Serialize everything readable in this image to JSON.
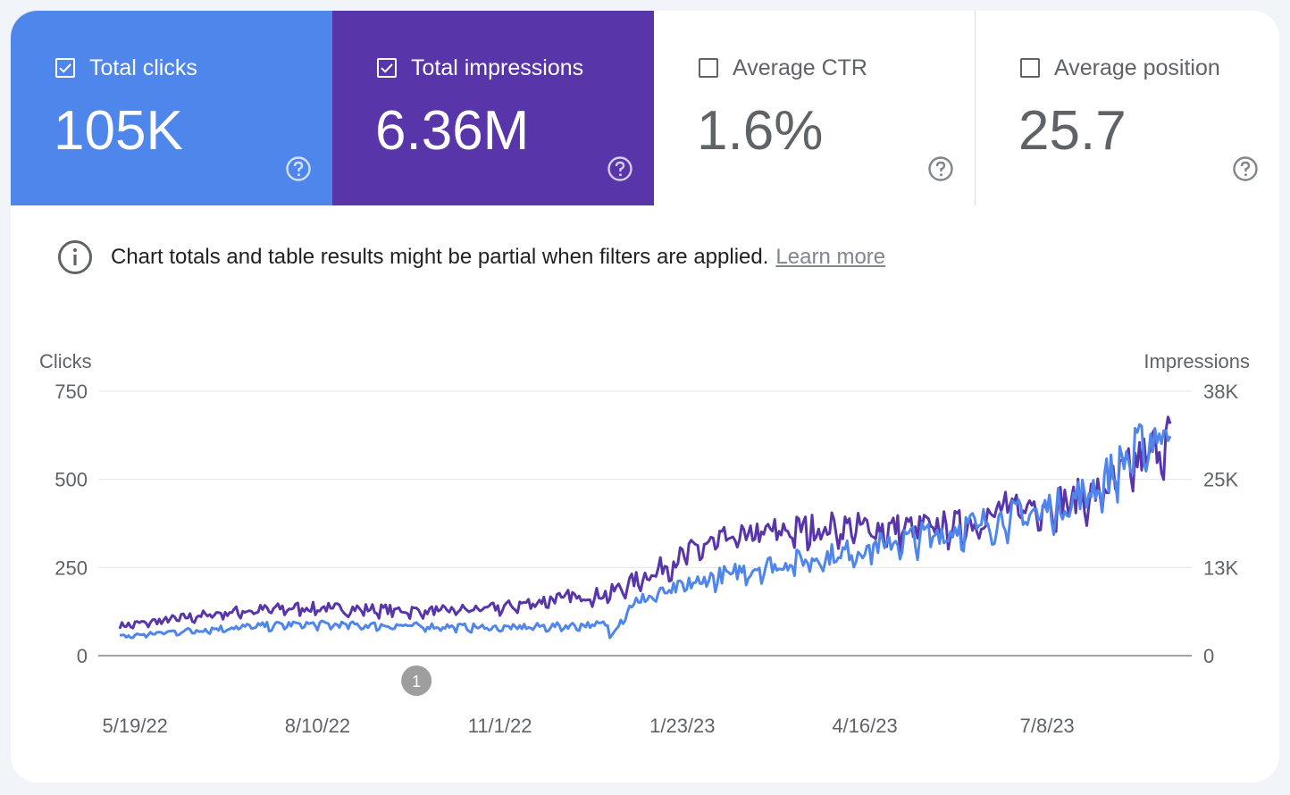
{
  "metrics": [
    {
      "label": "Total clicks",
      "value": "105K",
      "checked": true,
      "color": "#4f86ec"
    },
    {
      "label": "Total impressions",
      "value": "6.36M",
      "checked": true,
      "color": "#5935aa"
    },
    {
      "label": "Average CTR",
      "value": "1.6%",
      "checked": false
    },
    {
      "label": "Average position",
      "value": "25.7",
      "checked": false
    }
  ],
  "icons": {
    "checkbox": "checkbox-icon",
    "help": "help-circle-icon",
    "info": "info-circle-icon"
  },
  "notice": {
    "text": "Chart totals and table results might be partial when filters are applied.",
    "link": "Learn more"
  },
  "chart_data": {
    "type": "line",
    "y_left_title": "Clicks",
    "y_right_title": "Impressions",
    "y_left_ticks": [
      "750",
      "500",
      "250",
      "0"
    ],
    "y_right_ticks": [
      "38K",
      "25K",
      "13K",
      "0"
    ],
    "y_left_range": [
      0,
      750
    ],
    "y_right_range": [
      0,
      38000
    ],
    "x_ticks": [
      "5/19/22",
      "8/10/22",
      "11/1/22",
      "1/23/23",
      "4/16/23",
      "7/8/23"
    ],
    "x_range": [
      "5/12/22",
      "9/2/23"
    ],
    "annotation_marker": {
      "label": "1",
      "date": "9/24/22"
    },
    "grid": true,
    "series": [
      {
        "name": "Total clicks",
        "axis": "left",
        "color": "#4f86ec",
        "x": [
          "5/12/22",
          "6/1/22",
          "7/1/22",
          "8/1/22",
          "9/1/22",
          "10/1/22",
          "11/1/22",
          "12/1/22",
          "12/20/22",
          "12/21/22",
          "1/1/23",
          "1/20/23",
          "2/1/23",
          "3/1/23",
          "4/1/23",
          "5/1/23",
          "6/1/23",
          "7/1/23",
          "7/15/23",
          "8/1/23",
          "8/15/23",
          "9/2/23"
        ],
        "values": [
          52,
          65,
          78,
          88,
          85,
          82,
          78,
          83,
          88,
          55,
          150,
          185,
          210,
          250,
          280,
          320,
          360,
          400,
          420,
          480,
          560,
          650
        ]
      },
      {
        "name": "Total impressions",
        "axis": "right",
        "color": "#5935aa",
        "x": [
          "5/12/22",
          "6/1/22",
          "7/1/22",
          "8/1/22",
          "9/1/22",
          "10/1/22",
          "11/1/22",
          "12/1/22",
          "12/20/22",
          "1/1/23",
          "1/20/23",
          "2/1/23",
          "3/1/23",
          "4/1/23",
          "5/1/23",
          "6/1/23",
          "6/15/23",
          "7/1/23",
          "7/15/23",
          "8/1/23",
          "8/15/23",
          "9/2/23"
        ],
        "values": [
          4200,
          5000,
          6200,
          6800,
          6600,
          6300,
          6800,
          8300,
          8700,
          10500,
          13500,
          15500,
          17500,
          18200,
          18000,
          18500,
          20500,
          21500,
          21800,
          23000,
          26500,
          31500
        ]
      }
    ]
  }
}
